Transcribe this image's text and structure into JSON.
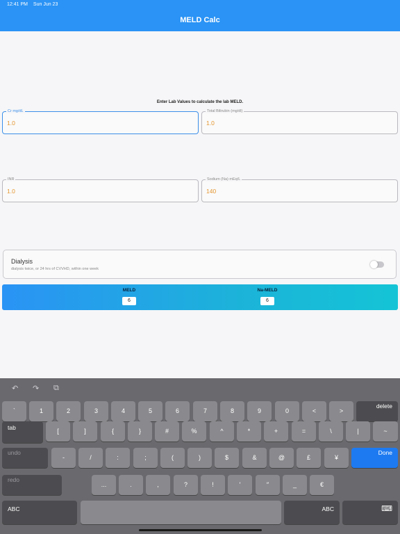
{
  "status": {
    "time": "12:41 PM",
    "date": "Sun Jun 23"
  },
  "nav": {
    "title": "MELD Calc"
  },
  "form": {
    "instructions": "Enter Lab Values to calculate the lab MELD.",
    "cr": {
      "label": "Cr mg/dL",
      "value": "1.0"
    },
    "bilirubin": {
      "label": "Total Bilirubin (mg/dl)",
      "value": "1.0"
    },
    "inr": {
      "label": "INR",
      "value": "1.0"
    },
    "sodium": {
      "label": "Sodium (Na) mEq/L",
      "value": "140"
    }
  },
  "dialysis": {
    "title": "Dialysis",
    "subtitle": "dialysis twice, or 24 hrs of CVVHD, within one week",
    "on": false
  },
  "results": {
    "meld_label": "MELD",
    "meld_value": "6",
    "na_meld_label": "Na-MELD",
    "na_meld_value": "6"
  },
  "keyboard": {
    "toolbar": {
      "undo": "↶",
      "redo": "↷",
      "paste": "⧉"
    },
    "row1": [
      "`",
      "1",
      "2",
      "3",
      "4",
      "5",
      "6",
      "7",
      "8",
      "9",
      "0",
      "<",
      ">"
    ],
    "delete": "delete",
    "tab": "tab",
    "row2": [
      "[",
      "]",
      "{",
      "}",
      "#",
      "%",
      "^",
      "*",
      "+",
      "=",
      "\\",
      "|",
      "~"
    ],
    "undo": "undo",
    "row3": [
      "-",
      "/",
      ":",
      ";",
      "(",
      ")",
      "$",
      "&",
      "@",
      "£",
      "¥"
    ],
    "done": "Done",
    "redo": "redo",
    "row4": [
      "...",
      ".",
      ",",
      "?",
      "!",
      "′",
      "″",
      "_",
      "€"
    ],
    "abc": "ABC",
    "keyboard_icon": "⌨"
  },
  "colors": {
    "accent": "#2a93f5",
    "value_text": "#e4952e",
    "done_key": "#1e7af0"
  }
}
